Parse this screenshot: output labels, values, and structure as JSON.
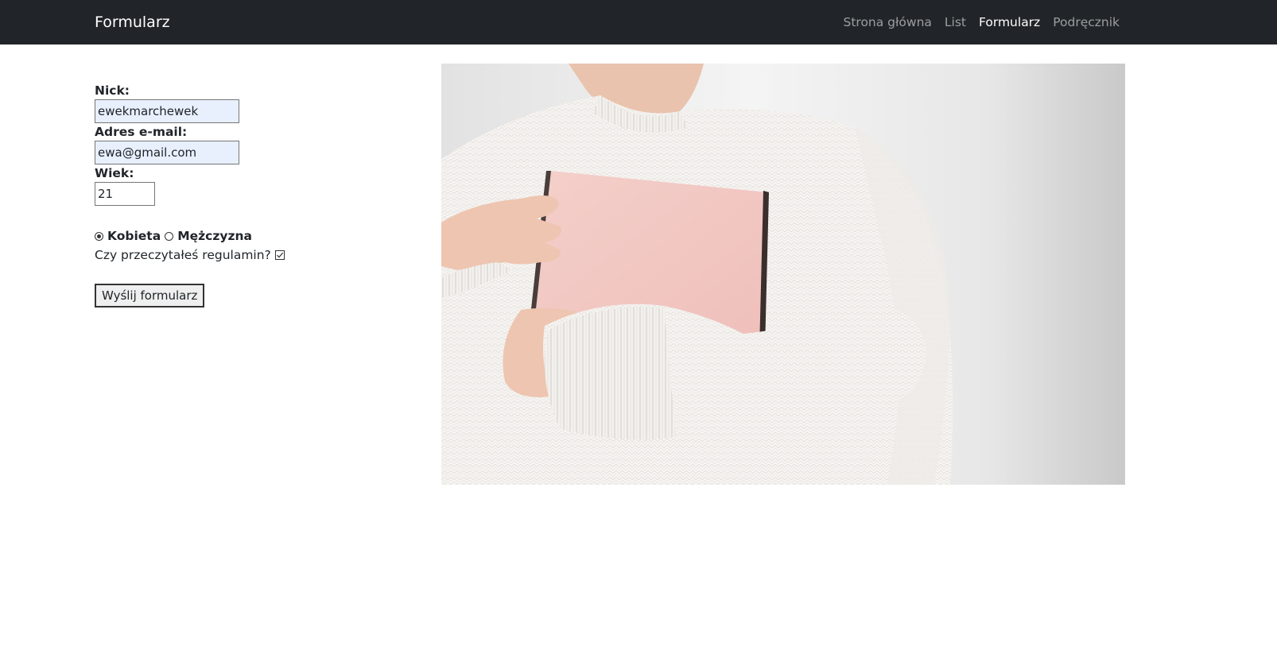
{
  "navbar": {
    "brand": "Formularz",
    "links": [
      {
        "label": "Strona główna",
        "active": false
      },
      {
        "label": "List",
        "active": false
      },
      {
        "label": "Formularz",
        "active": true
      },
      {
        "label": "Podręcznik",
        "active": false
      }
    ]
  },
  "form": {
    "nick_label": "Nick:",
    "nick_value": "ewekmarchewek",
    "email_label": "Adres e-mail:",
    "email_value": "ewa@gmail.com",
    "age_label": "Wiek:",
    "age_value": "21",
    "gender_options": [
      {
        "label": "Kobieta",
        "checked": true
      },
      {
        "label": "Mężczyzna",
        "checked": false
      }
    ],
    "terms_label": "Czy przeczytałeś regulamin?",
    "terms_checked": true,
    "submit_label": "Wyślij formularz"
  },
  "image": {
    "icon": "photo-woman-white-sweater-holding-pink-book"
  },
  "colors": {
    "navbar_bg": "#212529",
    "autofill_bg": "#e8f0fe",
    "book_pink": "#f2c7c2",
    "sweater_white": "#f7f5f3"
  }
}
